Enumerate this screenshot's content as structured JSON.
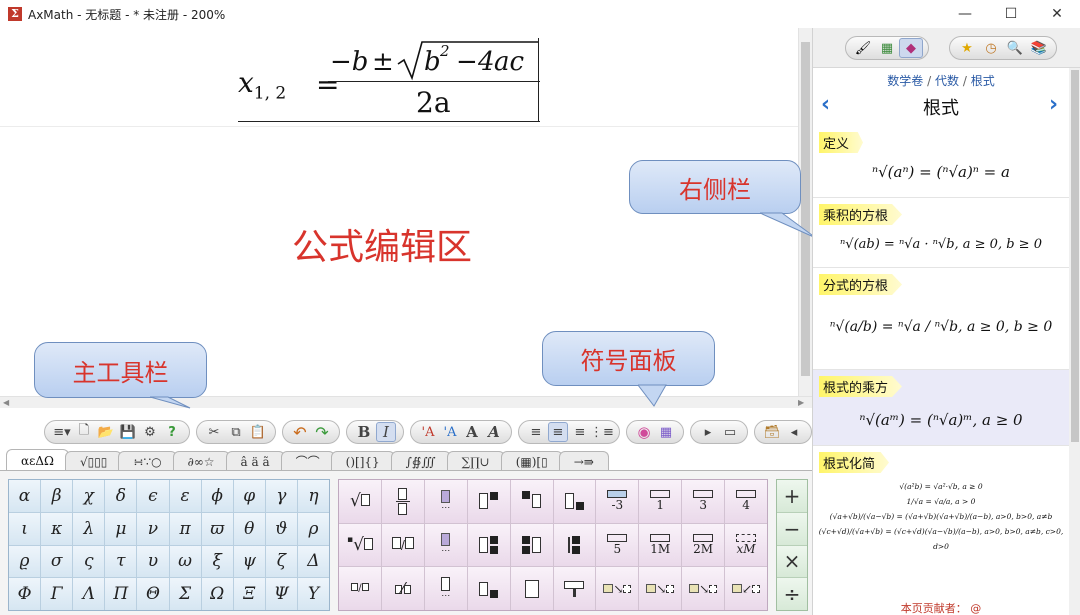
{
  "window": {
    "title": "AxMath - 无标题 - * 未注册 - 200%",
    "app_icon": "Σ",
    "controls": {
      "minimize": "—",
      "maximize": "☐",
      "close": "✕"
    }
  },
  "editor": {
    "formula": {
      "lhs": "x",
      "lhs_sub": "1, 2",
      "eq": "=",
      "numerator": "−b ± √(b² − 4ac)",
      "denominator": "2a"
    },
    "label": "公式编辑区"
  },
  "callouts": {
    "sidebar": "右侧栏",
    "toolbar": "主工具栏",
    "symbols": "符号面板"
  },
  "toolbar": {
    "buttons": [
      "≡▾",
      "🗋",
      "📂",
      "💾",
      "⚙",
      "?",
      "✂",
      "⧉",
      "📋",
      "↶",
      "↷",
      "B",
      "I",
      "'A",
      "'A",
      "A",
      "A",
      "≡",
      "≡",
      "≡",
      "⋮≡",
      "◉",
      "▦",
      "▸",
      "▭",
      "🗃",
      "◂"
    ]
  },
  "tabs": [
    "αεΔΩ",
    "√▯▯▯",
    "∺∵○",
    "∂∞☆",
    "â ä ã",
    "⌒⌒",
    "()[]{}",
    "∫∯∭",
    "∑∏∪",
    "(▦)[▯",
    "→⇛"
  ],
  "greek": [
    [
      "α",
      "β",
      "χ",
      "δ",
      "ϵ",
      "ε",
      "ϕ",
      "φ",
      "γ",
      "η"
    ],
    [
      "ι",
      "κ",
      "λ",
      "μ",
      "ν",
      "π",
      "ϖ",
      "θ",
      "ϑ",
      "ρ"
    ],
    [
      "ϱ",
      "σ",
      "ς",
      "τ",
      "υ",
      "ω",
      "ξ",
      "ψ",
      "ζ",
      "Δ"
    ],
    [
      "Φ",
      "Γ",
      "Λ",
      "Π",
      "Θ",
      "Σ",
      "Ω",
      "Ξ",
      "Ψ",
      "Υ"
    ]
  ],
  "templates": {
    "row3_labels": [
      "-3",
      "1",
      "3",
      "4"
    ],
    "row2_labels": [
      "5",
      "1M",
      "2M",
      "xM"
    ]
  },
  "ops": [
    "+",
    "−",
    "×",
    "÷"
  ],
  "sidebar": {
    "breadcrumb": [
      "数学卷",
      "代数",
      "根式"
    ],
    "breadcrumb_sep": "/",
    "title": "根式",
    "prev": "‹",
    "next": "›",
    "sections": [
      {
        "heading": "定义",
        "formula": "ⁿ√(aⁿ) = (ⁿ√a)ⁿ = a"
      },
      {
        "heading": "乘积的方根",
        "formula": "ⁿ√(ab) = ⁿ√a · ⁿ√b,  a ≥ 0,  b ≥ 0"
      },
      {
        "heading": "分式的方根",
        "formula": "ⁿ√(a/b) = ⁿ√a / ⁿ√b,  a ≥ 0,  b ≥ 0"
      },
      {
        "heading": "根式的乘方",
        "formula": "ⁿ√(aᵐ) = (ⁿ√a)ᵐ, a ≥ 0"
      },
      {
        "heading": "根式化简",
        "formula_lines": [
          "√(a²b) = √a²·√b, a ≥ 0",
          "1/√a = √a/a, a > 0",
          "(√a+√b)/(√a−√b) = (√a+√b)(√a+√b)/(a−b), a>0, b>0, a≠b",
          "(√c+√d)/(√a+√b) = (√c+√d)(√a−√b)/(a−b), a>0, b>0, a≠b, c>0, d>0"
        ]
      }
    ],
    "footer": "本页贡献者： @"
  }
}
